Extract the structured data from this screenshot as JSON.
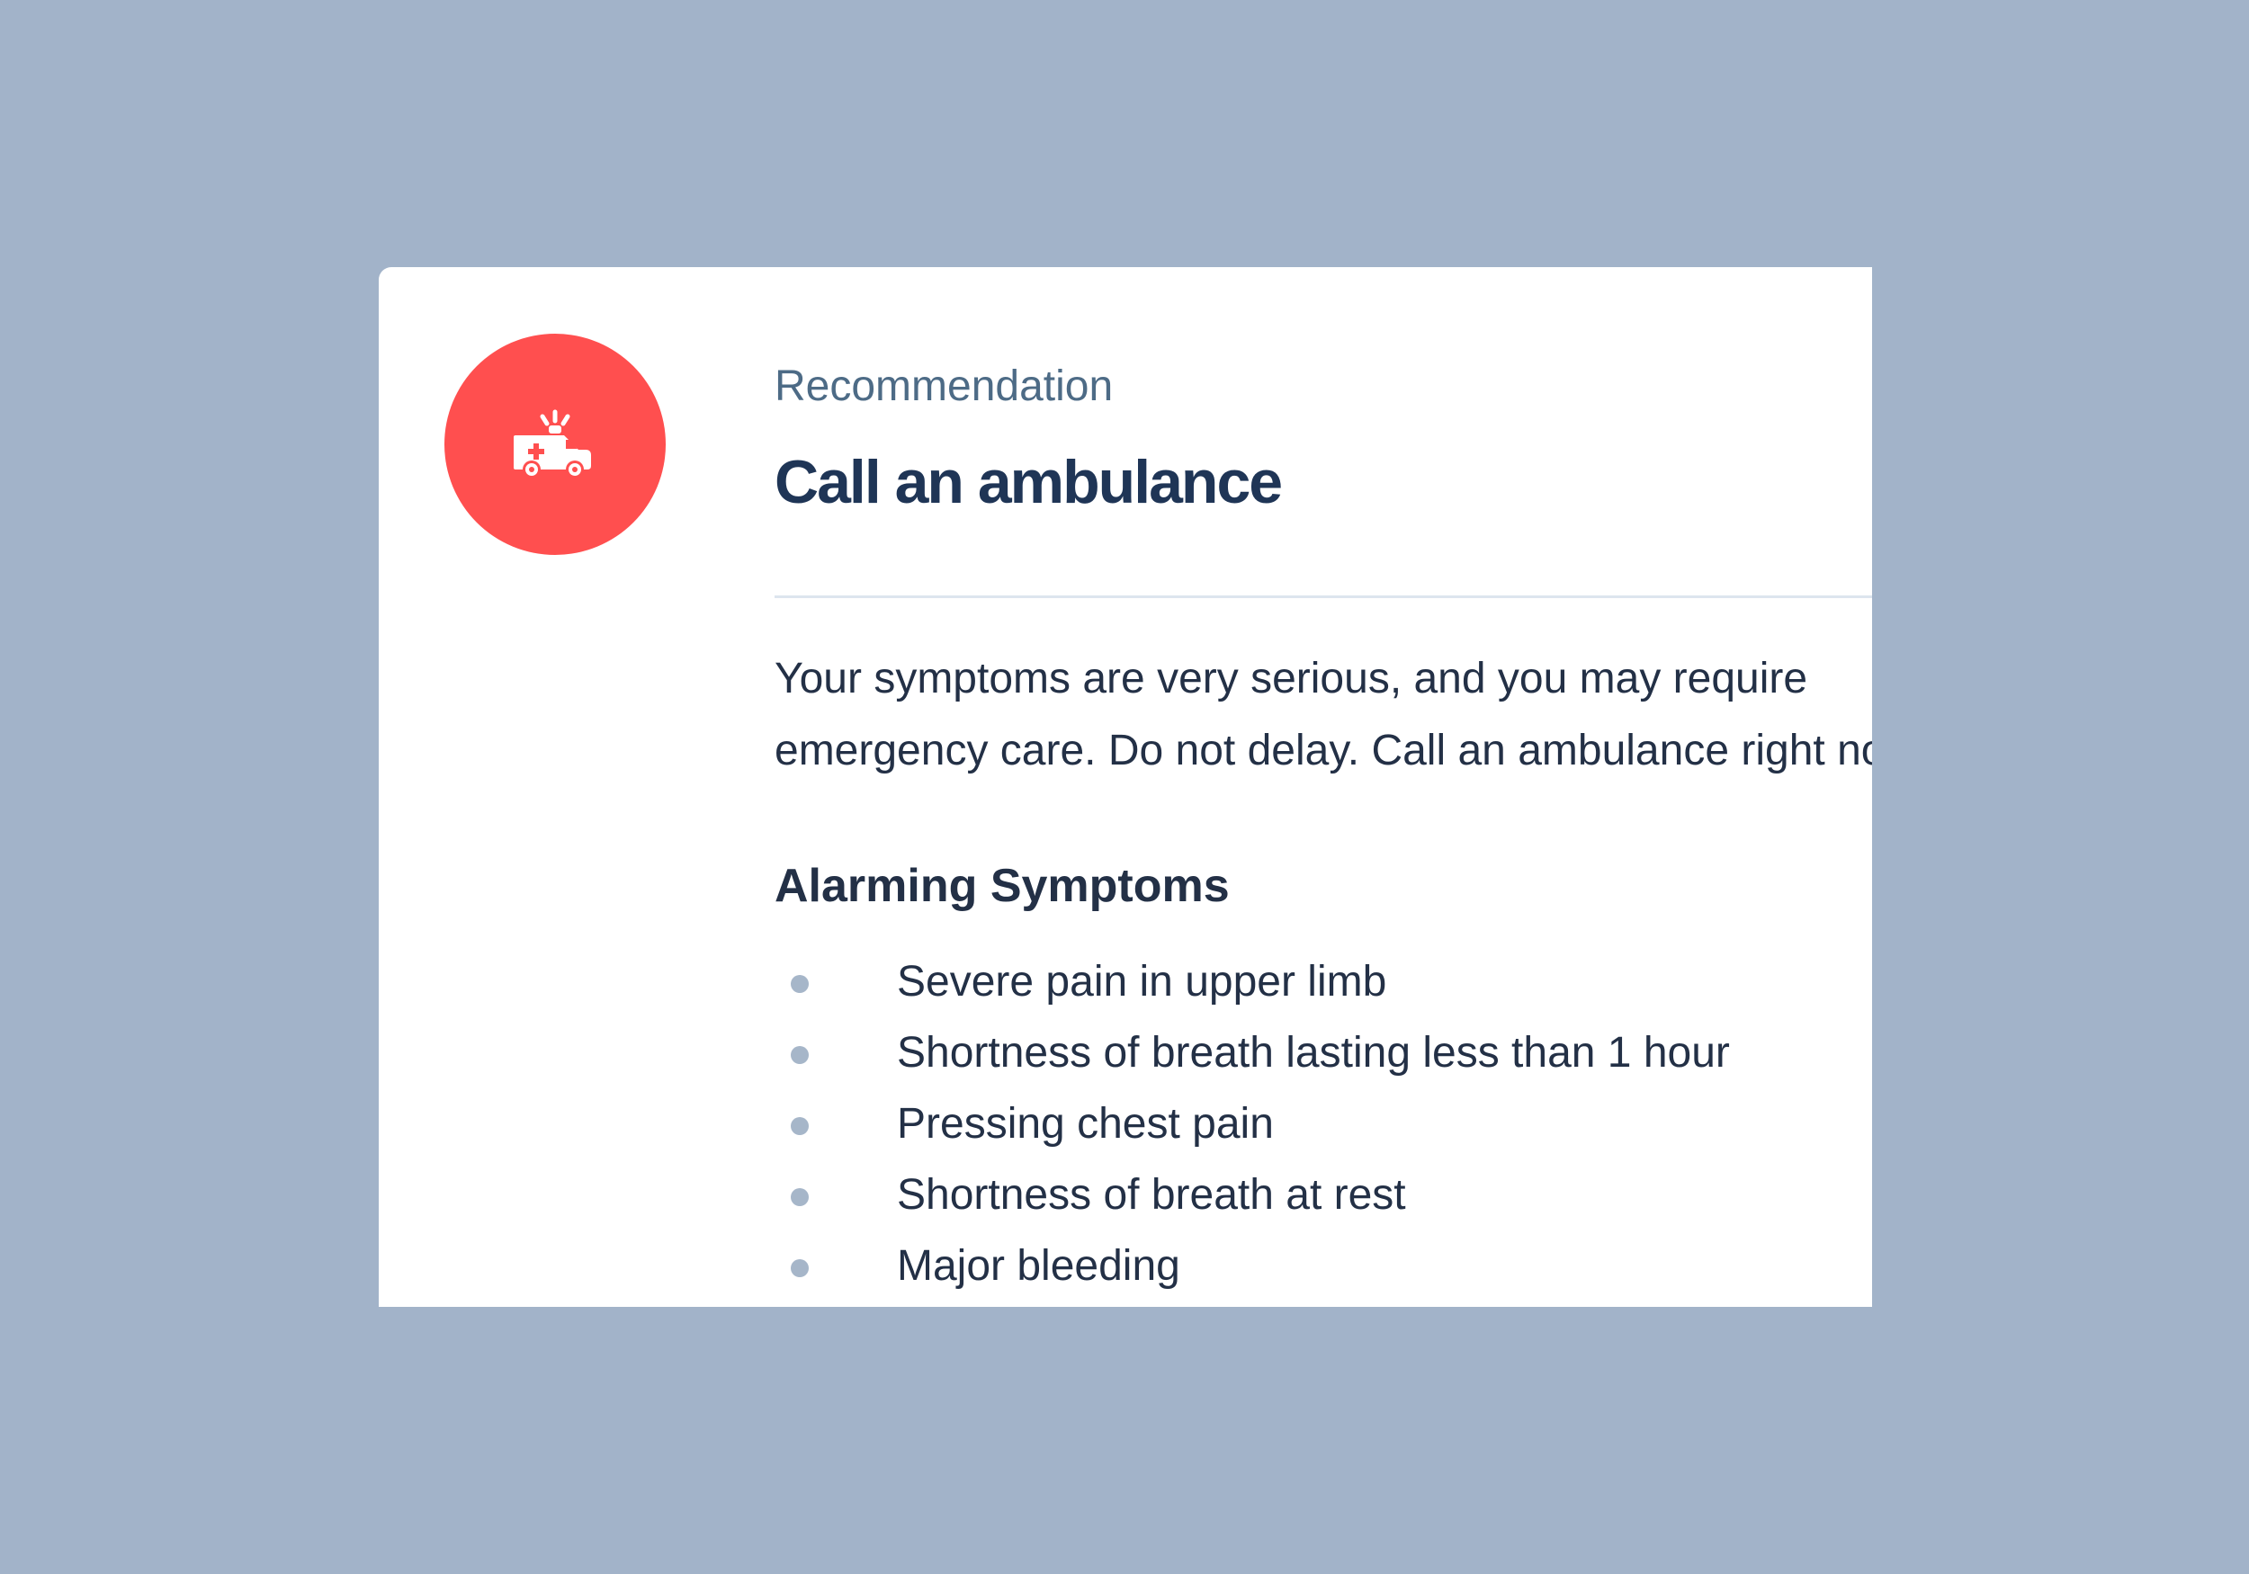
{
  "card": {
    "icon": "ambulance-icon",
    "icon_background": "#ff4f4f",
    "eyebrow": "Recommendation",
    "title": "Call an ambulance",
    "message": "Your symptoms are very serious, and you may require emergency care. Do not delay. Call an ambulance right now.",
    "section_heading": "Alarming Symptoms",
    "symptoms": [
      "Severe pain in upper limb",
      "Shortness of breath lasting less than 1 hour",
      "Pressing chest pain",
      "Shortness of breath at rest",
      "Major bleeding"
    ]
  },
  "colors": {
    "page_background": "#a2b3c9",
    "title": "#1f3556",
    "body_text": "#233046",
    "bullet": "#a6b6c9"
  }
}
